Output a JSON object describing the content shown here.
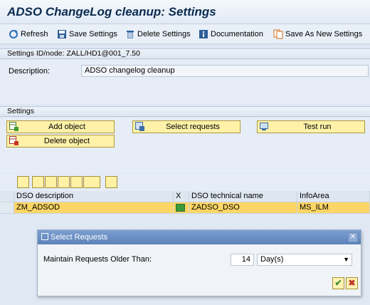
{
  "window": {
    "title": "ADSO ChangeLog cleanup: Settings"
  },
  "toolbar": {
    "refresh": "Refresh",
    "save_settings": "Save Settings",
    "delete_settings": "Delete Settings",
    "documentation": "Documentation",
    "save_as_new": "Save As New Settings"
  },
  "settings_id": {
    "header": "Settings ID/node: ZALL/HD1@001_7.50",
    "description_label": "Description:",
    "description_value": "ADSO changelog cleanup"
  },
  "settings": {
    "header": "Settings",
    "add_object": "Add object",
    "select_requests": "Select requests",
    "test_run": "Test run",
    "delete_object": "Delete object"
  },
  "grid": {
    "columns": [
      "DSO description",
      "X",
      "DSO technical name",
      "InfoArea"
    ],
    "rows": [
      {
        "description": "ZM_ADSOD",
        "x": "",
        "technical_name": "ZADSO_DSO",
        "infoarea": "MS_ILM"
      }
    ]
  },
  "dialog": {
    "title": "Select Requests",
    "close_glyph": "✕",
    "label": "Maintain Requests Older Than:",
    "value": "14",
    "unit": "Day(s)"
  },
  "icons": {
    "ok": "✔",
    "cancel": "✖"
  }
}
